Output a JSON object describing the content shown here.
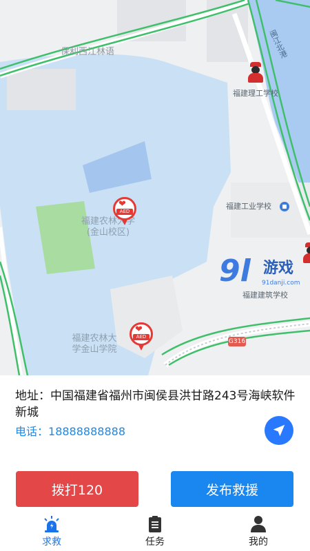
{
  "map": {
    "labels": {
      "poly_xijiang": "保利西江林语",
      "river": "闽江北港",
      "campus1": "福建农林大学\n(金山校区)",
      "campus2": "福建农林大\n学金山学院",
      "school_ligong": "福建理工学校",
      "school_gongye": "福建工业学校",
      "school_jianzhu": "福建建筑学校",
      "road_code": "G316"
    },
    "aed_badge": "AED",
    "watermark": {
      "number": "9l",
      "brand": "游戏",
      "domain": "91danji.com"
    }
  },
  "info": {
    "address_label": "地址：",
    "address_value": "中国福建省福州市闽侯县洪甘路243号海峡软件新城",
    "phone_label": "电话：",
    "phone_value": "18888888888"
  },
  "actions": {
    "call_label": "拨打120",
    "publish_label": "发布救援"
  },
  "bottom_nav": {
    "items": [
      {
        "label": "求救",
        "icon": "siren-icon",
        "active": true
      },
      {
        "label": "任务",
        "icon": "clipboard-icon",
        "active": false
      },
      {
        "label": "我的",
        "icon": "user-icon",
        "active": false
      }
    ]
  },
  "colors": {
    "primary": "#1a86f0",
    "danger": "#e34747",
    "active_tab": "#1a73e8",
    "phone": "#1e88e5"
  }
}
